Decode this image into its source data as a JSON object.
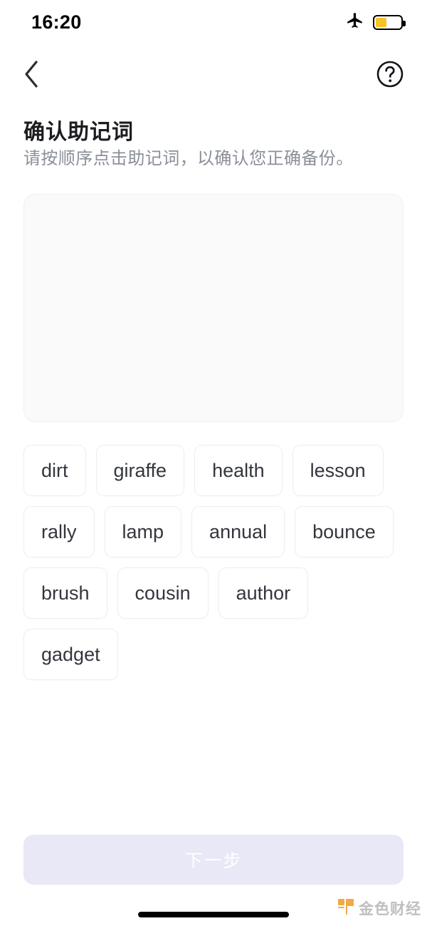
{
  "status_bar": {
    "time": "16:20",
    "airplane_icon": "airplane-mode-icon",
    "battery_icon": "battery-icon",
    "battery_level_percent": 45,
    "battery_color": "#F7C325"
  },
  "nav_bar": {
    "back_icon": "chevron-left-icon",
    "help_icon": "question-mark-circle-icon"
  },
  "header": {
    "title": "确认助记词",
    "subtitle": "请按顺序点击助记词，以确认您正确备份。"
  },
  "answer_box": {
    "selected_words": [],
    "placeholder": ""
  },
  "word_pool": {
    "words": [
      "dirt",
      "giraffe",
      "health",
      "lesson",
      "rally",
      "lamp",
      "annual",
      "bounce",
      "brush",
      "cousin",
      "author",
      "gadget"
    ]
  },
  "footer": {
    "next_label": "下一步",
    "next_enabled": false,
    "next_bg_color": "#e8e8f6",
    "next_text_color": "#ffffff"
  },
  "watermark": {
    "text": "金色财经",
    "logo_color": "#F0A030"
  }
}
